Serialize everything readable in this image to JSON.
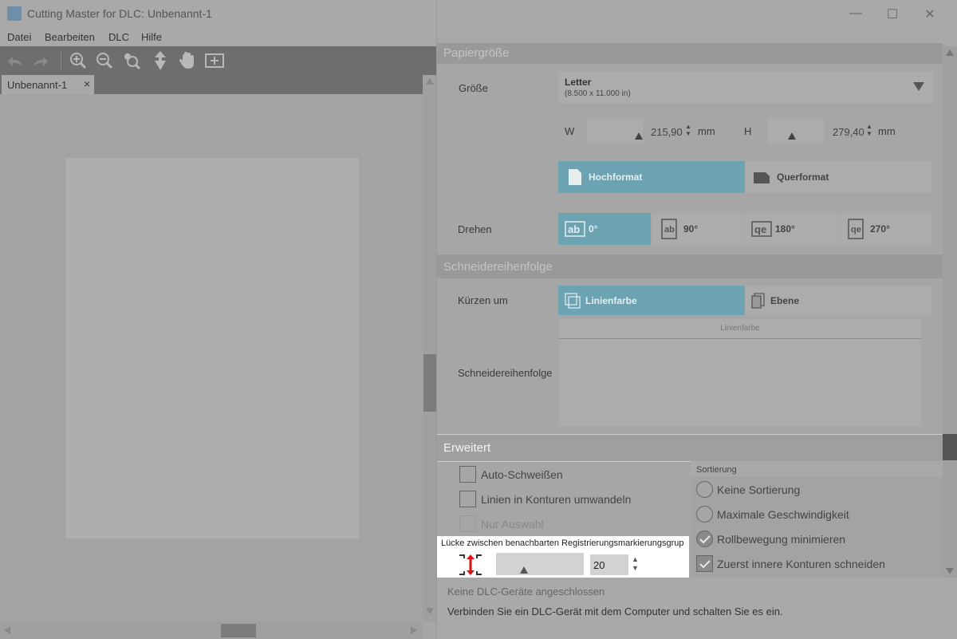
{
  "window": {
    "title": "Cutting Master for DLC: Unbenannt-1",
    "app_icon": "dlc-app-icon"
  },
  "menu": {
    "items": [
      "Datei",
      "Bearbeiten",
      "DLC",
      "Hilfe"
    ]
  },
  "toolbar": {
    "icons": [
      "undo-icon",
      "redo-icon",
      "zoom-in-icon",
      "zoom-out-icon",
      "zoom-selection-icon",
      "move-icon",
      "pan-hand-icon",
      "fit-page-icon"
    ]
  },
  "document": {
    "tab_label": "Unbenannt-1",
    "tab_close": "×"
  },
  "paper_size": {
    "section_title": "Papiergröße",
    "size_label": "Größe",
    "size_value": "Letter",
    "size_sub": "(8.500 x 11.000 in)",
    "width_label": "W",
    "width_value": "215,90",
    "width_unit": "mm",
    "height_label": "H",
    "height_value": "279,40",
    "height_unit": "mm",
    "orientation": {
      "portrait": "Hochformat",
      "landscape": "Querformat",
      "selected": "portrait"
    },
    "rotate_label": "Drehen",
    "rotate_options": [
      "0°",
      "90°",
      "180°",
      "270°"
    ],
    "rotate_selected": 0
  },
  "cut_order": {
    "section_title": "Schneidereihenfolge",
    "sort_by_label": "Kürzen um",
    "sort_options": {
      "line_color": "Linienfarbe",
      "layer": "Ebene",
      "selected": "line_color"
    },
    "list_label": "Schneidereihenfolge",
    "list_header": "Linienfarbe"
  },
  "advanced": {
    "section_title": "Erweitert",
    "auto_weld": "Auto-Schweißen",
    "lines_to_contours": "Linien in Konturen umwandeln",
    "selection_only": "Nur Auswahl",
    "gap_label": "Lücke zwischen benachbarten Registrierungsmarkierungsgrup",
    "gap_value": "20",
    "sort_group_title": "Sortierung",
    "sort_options": [
      "Keine Sortierung",
      "Maximale Geschwindigkeit",
      "Rollbewegung minimieren",
      "Zuerst innere Konturen schneiden"
    ],
    "sort_selected": 2,
    "inner_first_checked": true
  },
  "status": {
    "line1": "Keine DLC-Geräte angeschlossen",
    "line2": "Verbinden Sie ein DLC-Gerät mit dem Computer und schalten Sie es ein."
  },
  "colors": {
    "accent": "#6ba3b3",
    "highlight_arrow": "#e01010"
  }
}
